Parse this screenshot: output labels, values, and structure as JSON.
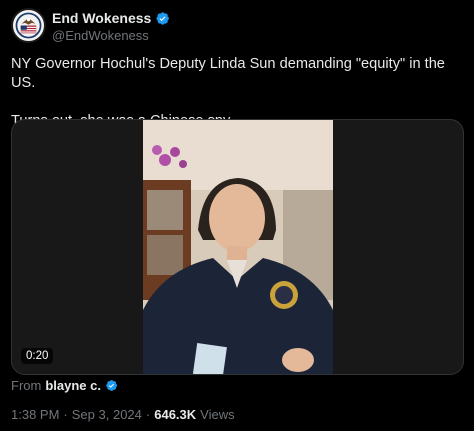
{
  "author": {
    "display_name": "End Wokeness",
    "handle": "@EndWokeness",
    "avatar_icon": "eagle-seal-avatar",
    "verified_icon": "verified-badge-icon",
    "verified_color": "#1d9bf0"
  },
  "tweet": {
    "line1": "NY Governor Hochul's Deputy Linda Sun demanding \"equity\" in the US.",
    "line2": "Turns out, she was a Chinese spy."
  },
  "video": {
    "duration": "0:20"
  },
  "attribution": {
    "prefix": "From",
    "name": "blayne c."
  },
  "meta": {
    "time": "1:38 PM",
    "sep1": "·",
    "date": "Sep 3, 2024",
    "sep2": "·",
    "views_count": "646.3K",
    "views_label": "Views"
  }
}
